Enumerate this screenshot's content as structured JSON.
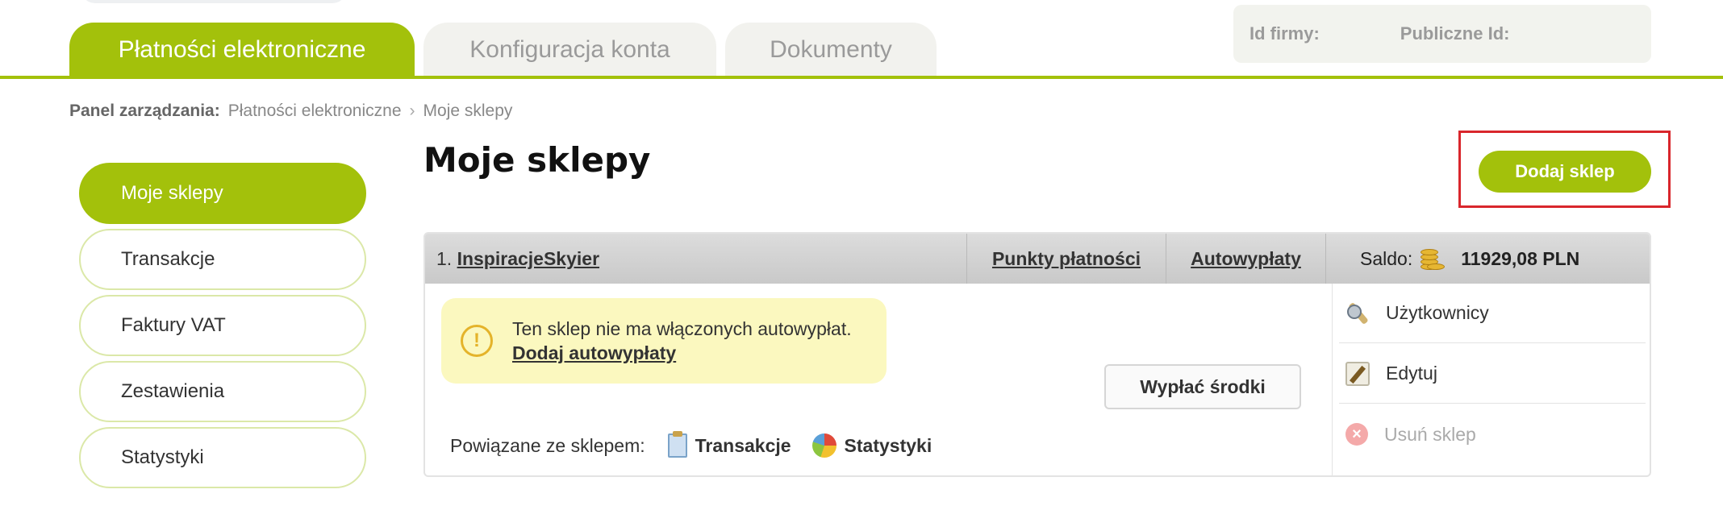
{
  "tabs": [
    {
      "label": "Płatności elektroniczne",
      "active": true
    },
    {
      "label": "Konfiguracja konta",
      "active": false
    },
    {
      "label": "Dokumenty",
      "active": false
    }
  ],
  "ids": {
    "company_id_label": "Id firmy:",
    "public_id_label": "Publiczne Id:"
  },
  "breadcrumb": {
    "label": "Panel zarządzania:",
    "parent": "Płatności elektroniczne",
    "separator": "›",
    "current": "Moje sklepy"
  },
  "sidebar": {
    "items": [
      {
        "label": "Moje sklepy",
        "active": true
      },
      {
        "label": "Transakcje"
      },
      {
        "label": "Faktury VAT"
      },
      {
        "label": "Zestawienia"
      },
      {
        "label": "Statystyki"
      }
    ]
  },
  "main": {
    "title": "Moje sklepy",
    "add_shop_label": "Dodaj sklep"
  },
  "shop": {
    "index": "1.",
    "name": "InspiracjeSkyier",
    "payment_points_label": "Punkty płatności",
    "autopayouts_label": "Autowypłaty",
    "balance_label": "Saldo:",
    "balance_value": "11929,08 PLN",
    "warning_text": "Ten sklep nie ma włączonych autowypłat.",
    "warning_link": "Dodaj autowypłaty",
    "withdraw_label": "Wypłać środki",
    "related_label": "Powiązane ze sklepem:",
    "related_links": {
      "transactions": "Transakcje",
      "statistics": "Statystyki"
    },
    "actions": {
      "users": "Użytkownicy",
      "edit": "Edytuj",
      "delete": "Usuń sklep"
    }
  },
  "colors": {
    "accent": "#a3c10b",
    "highlight_border": "#d9262c",
    "warning_bg": "#fbf8bf"
  }
}
